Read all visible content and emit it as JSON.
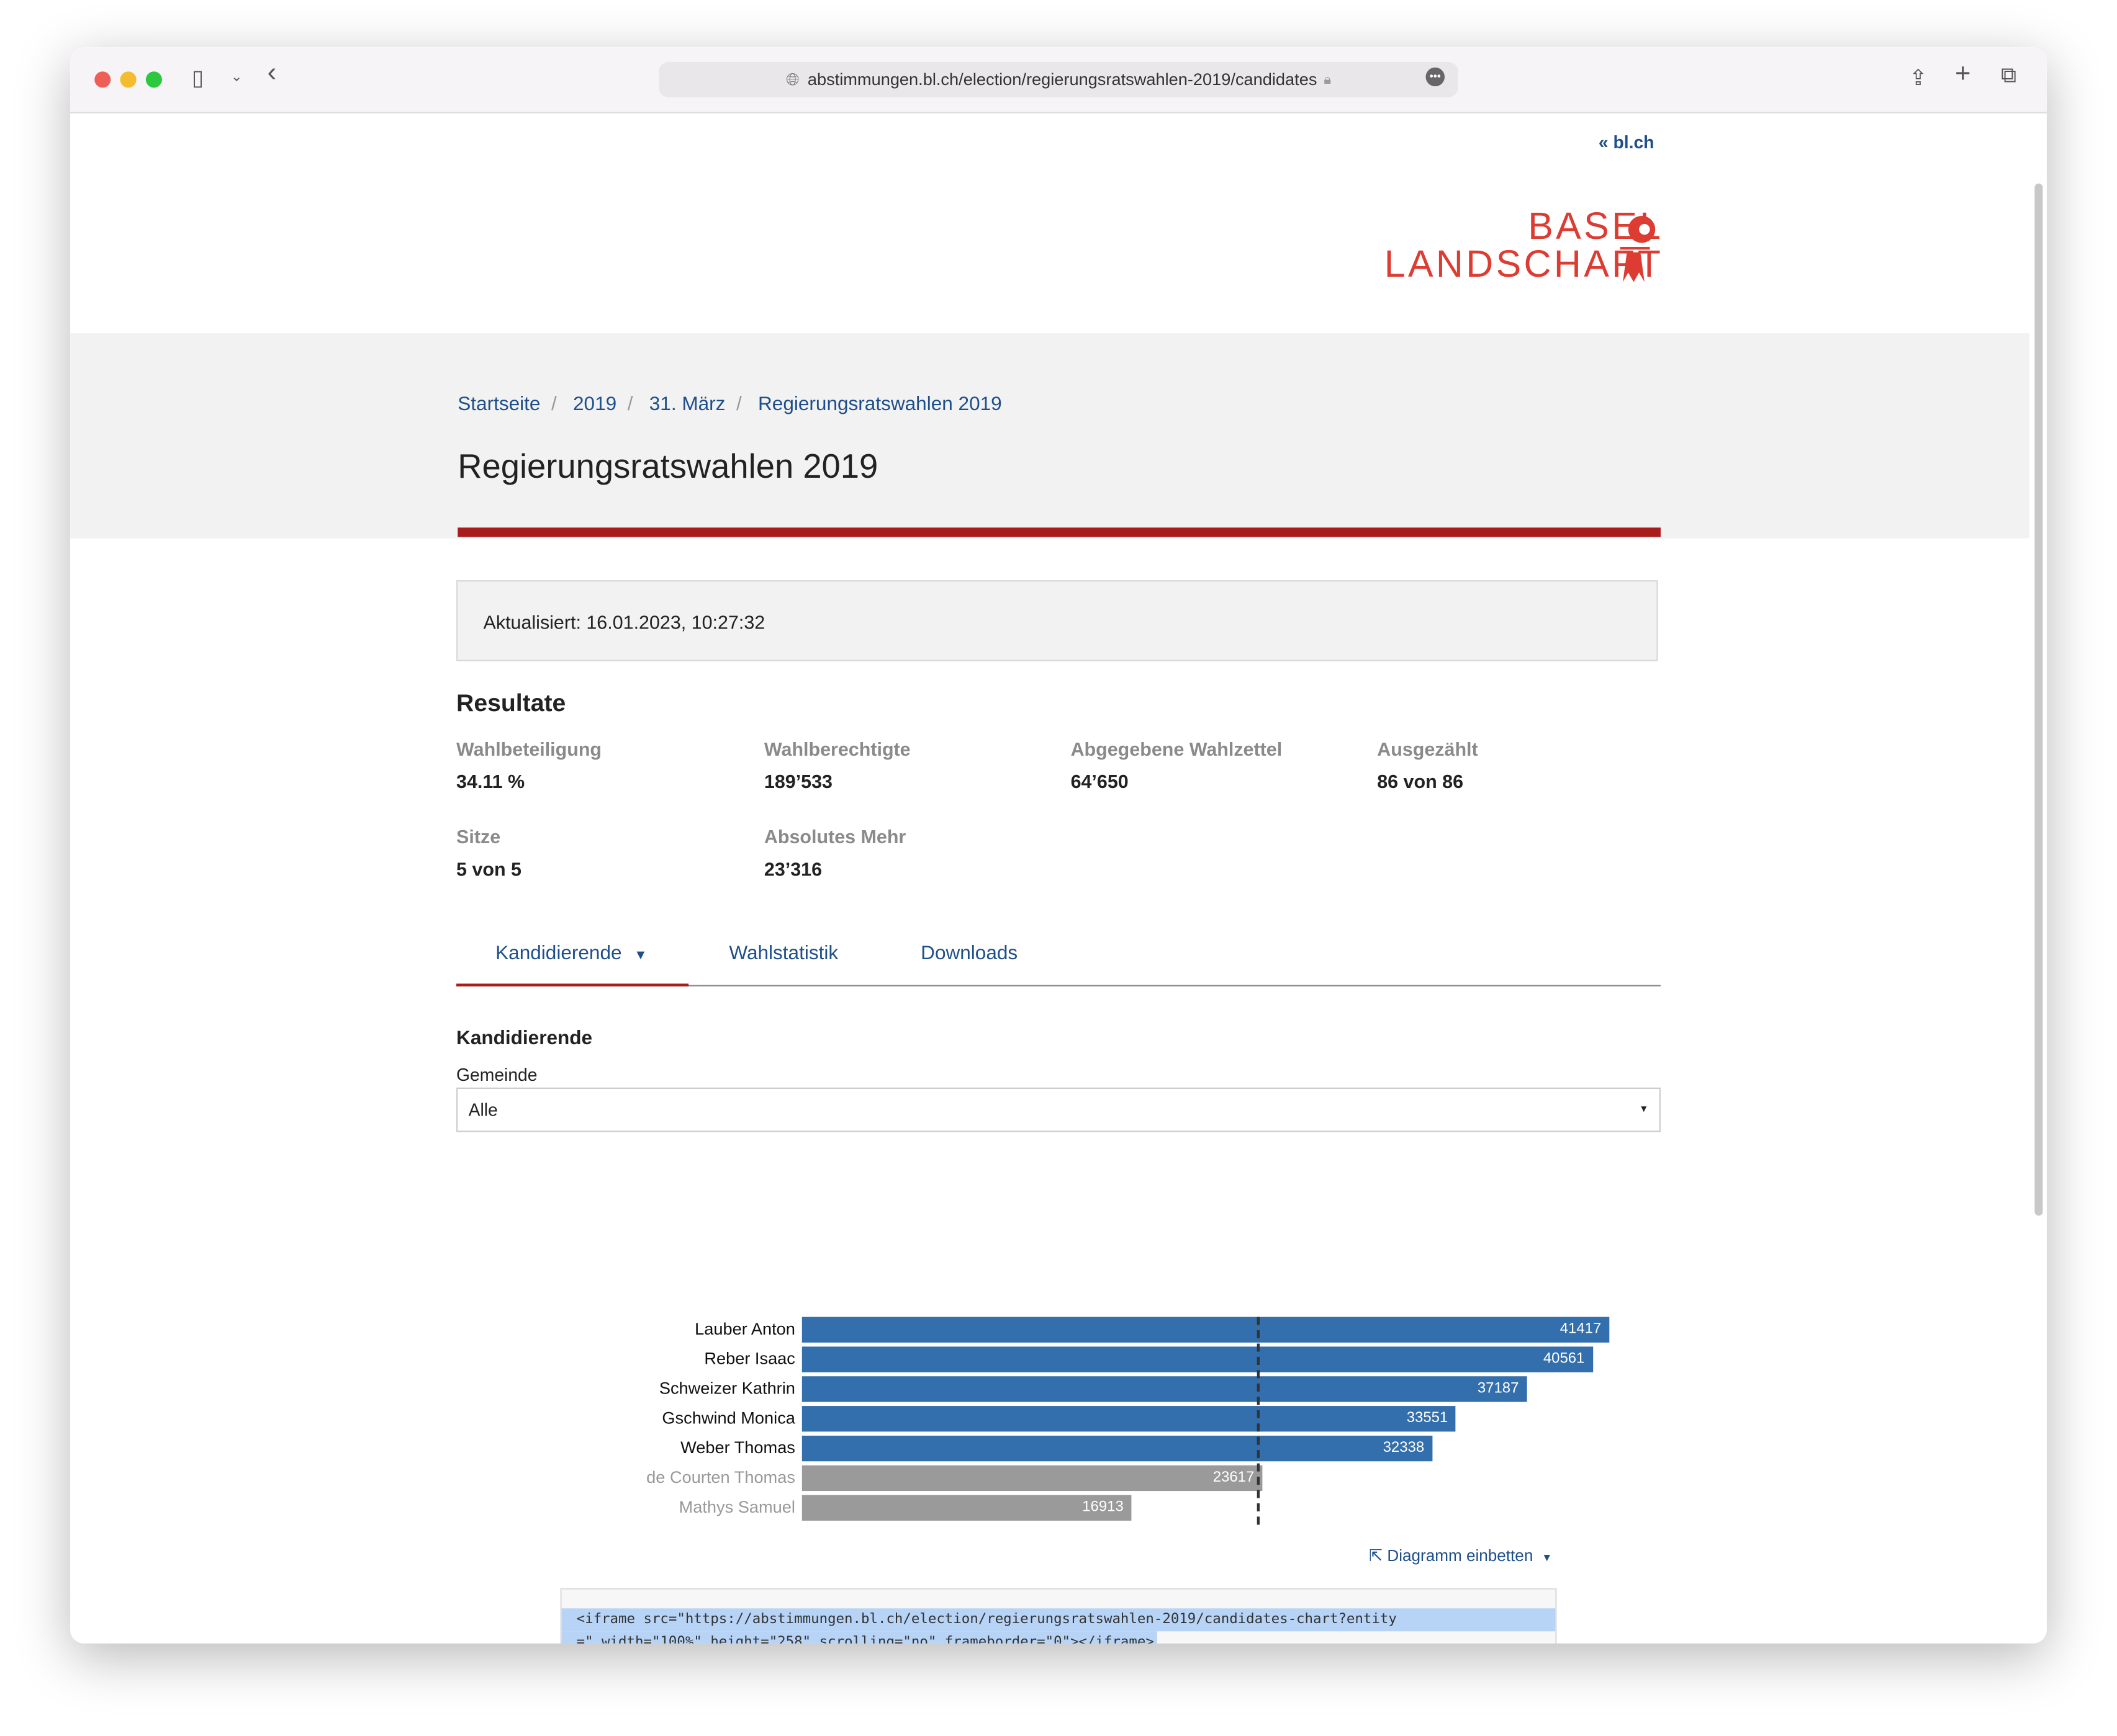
{
  "browser": {
    "url": "abstimmungen.bl.ch/election/regierungsratswahlen-2019/candidates"
  },
  "header": {
    "back_link": "bl.ch",
    "logo_text": [
      "BASEL",
      "LANDSCHAFT"
    ]
  },
  "breadcrumb": [
    "Startseite",
    "2019",
    "31. März",
    "Regierungsratswahlen 2019"
  ],
  "page_title": "Regierungsratswahlen 2019",
  "updated": "Aktualisiert: 16.01.2023, 10:27:32",
  "results": {
    "heading": "Resultate",
    "items": [
      {
        "label": "Wahlbeteiligung",
        "value": "34.11 %"
      },
      {
        "label": "Wahlberechtigte",
        "value": "189’533"
      },
      {
        "label": "Abgegebene Wahlzettel",
        "value": "64’650"
      },
      {
        "label": "Ausgezählt",
        "value": "86 von 86"
      },
      {
        "label": "Sitze",
        "value": "5 von 5"
      },
      {
        "label": "Absolutes Mehr",
        "value": "23’316"
      }
    ]
  },
  "tabs": [
    {
      "label": "Kandidierende",
      "active": true
    },
    {
      "label": "Wahlstatistik"
    },
    {
      "label": "Downloads"
    }
  ],
  "section": {
    "heading": "Kandidierende",
    "filter_label": "Gemeinde",
    "filter_value": "Alle"
  },
  "colors": {
    "elected": "#336fac",
    "not_elected": "#9a9a9a",
    "accent": "#a81c1c",
    "link": "#1f4f8b",
    "logo": "#dc3c32"
  },
  "chart_data": {
    "type": "bar",
    "orientation": "horizontal",
    "categories": [
      "Lauber Anton",
      "Reber Isaac",
      "Schweizer Kathrin",
      "Gschwind Monica",
      "Weber Thomas",
      "de Courten Thomas",
      "Mathys Samuel"
    ],
    "values": [
      41417,
      40561,
      37187,
      33551,
      32338,
      23617,
      16913
    ],
    "elected": [
      true,
      true,
      true,
      true,
      true,
      false,
      false
    ],
    "reference_line": {
      "value": 23316,
      "style": "dashed"
    }
  },
  "embed": {
    "toggle_label": "Diagramm einbetten",
    "code_line1": "<iframe src=\"https://abstimmungen.bl.ch/election/regierungsratswahlen-2019/candidates-chart?entity",
    "code_line2": "=\" width=\"100%\" height=\"258\" scrolling=\"no\" frameborder=\"0\"></iframe>"
  }
}
